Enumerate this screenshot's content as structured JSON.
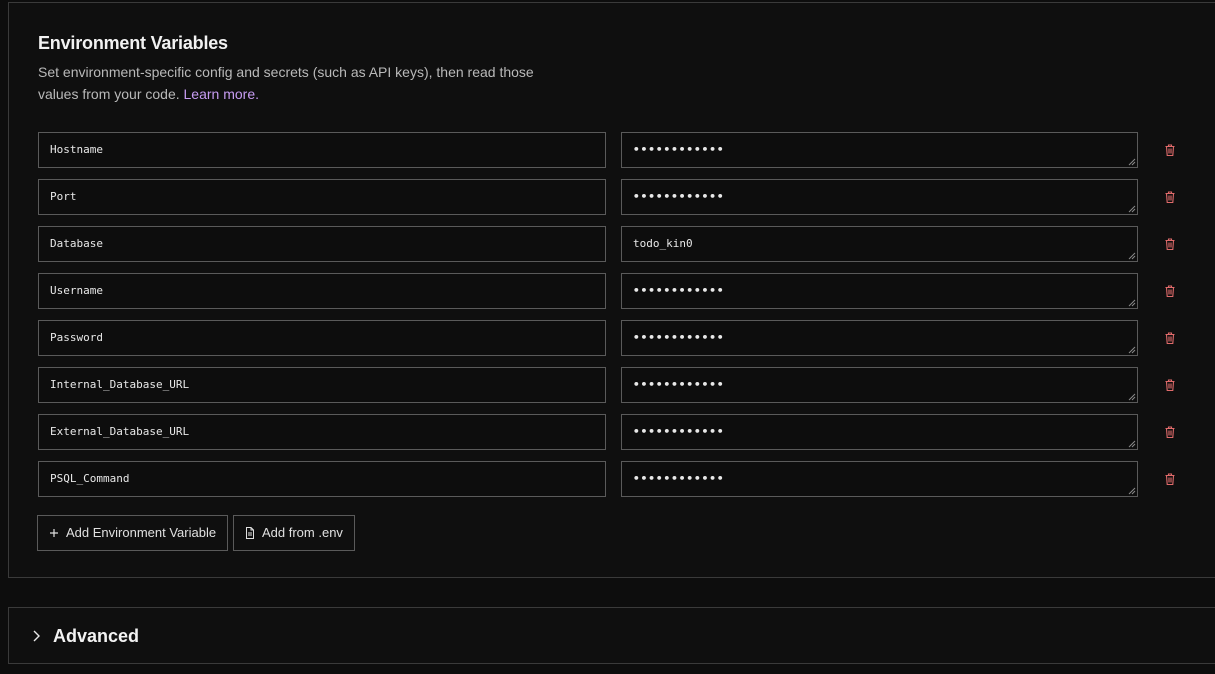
{
  "env_section": {
    "title": "Environment Variables",
    "description": "Set environment-specific config and secrets (such as API keys), then read those values from your code.",
    "learn_more": "Learn more.",
    "variables": [
      {
        "key": "Hostname",
        "value": "••••••••••••",
        "masked": true
      },
      {
        "key": "Port",
        "value": "••••••••••••",
        "masked": true
      },
      {
        "key": "Database",
        "value": "todo_kin0",
        "masked": false
      },
      {
        "key": "Username",
        "value": "••••••••••••",
        "masked": true
      },
      {
        "key": "Password",
        "value": "••••••••••••",
        "masked": true
      },
      {
        "key": "Internal_Database_URL",
        "value": "••••••••••••",
        "masked": true
      },
      {
        "key": "External_Database_URL",
        "value": "••••••••••••",
        "masked": true
      },
      {
        "key": "PSQL_Command",
        "value": "••••••••••••",
        "masked": true
      }
    ],
    "add_variable_label": "Add Environment Variable",
    "add_from_env_label": "Add from .env"
  },
  "advanced": {
    "label": "Advanced"
  },
  "colors": {
    "link": "#c79cf2",
    "delete": "#e06b6b",
    "border": "#5a5a5a"
  }
}
